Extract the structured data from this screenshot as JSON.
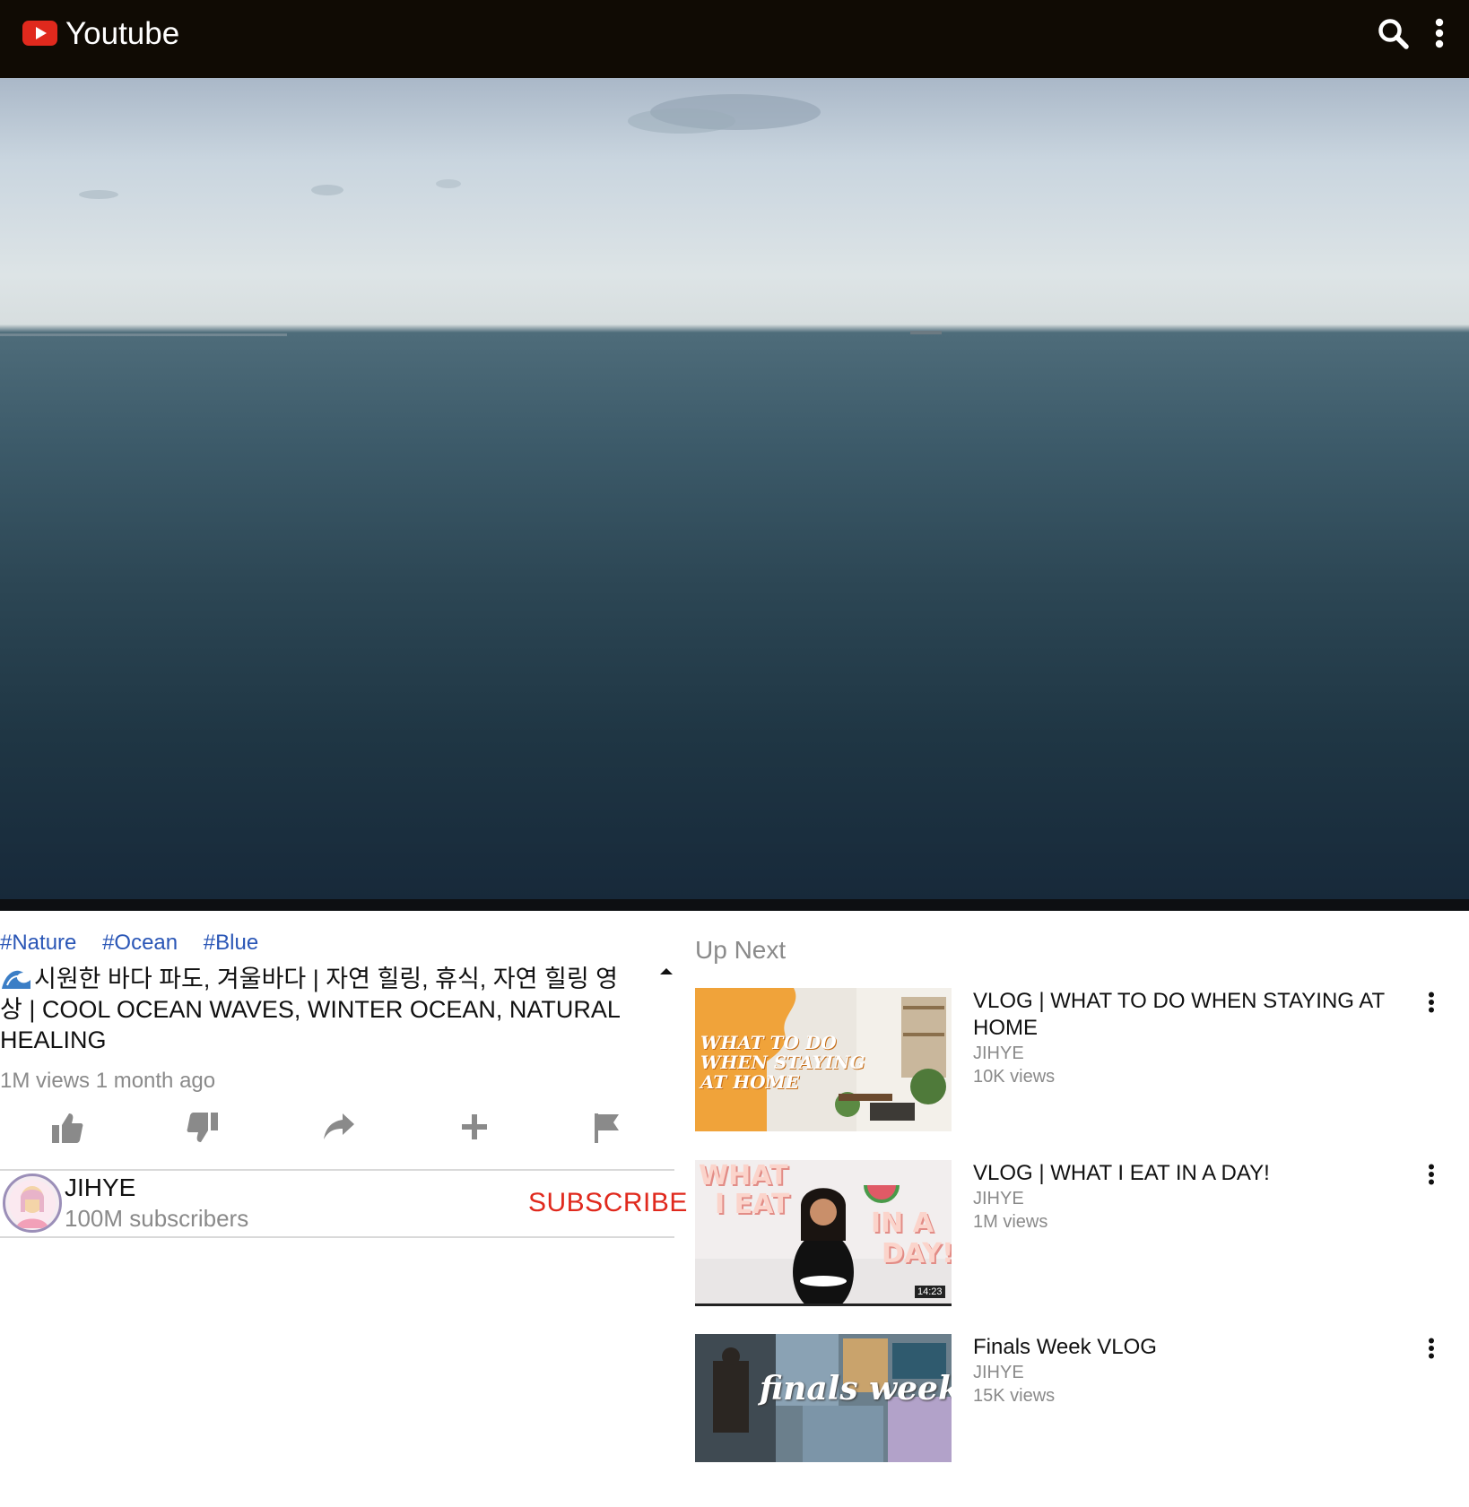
{
  "app": {
    "title": "Youtube",
    "accent": "#e0291d",
    "bar_color": "#100b04"
  },
  "video": {
    "tags": [
      "#Nature",
      "#Ocean",
      "#Blue"
    ],
    "title": "시원한 바다 파도, 겨울바다 | 자연 힐링, 휴식, 자연 힐링 영상 | COOL OCEAN WAVES, WINTER OCEAN, NATURAL HEALING",
    "meta": "1M views 1 month ago"
  },
  "actions": [
    "like-icon",
    "dislike-icon",
    "share-icon",
    "add-icon",
    "flag-icon"
  ],
  "channel": {
    "name": "JIHYE",
    "subscribers": "100M subscribers",
    "subscribe_label": "SUBSCRIBE"
  },
  "up_next": {
    "label": "Up Next",
    "items": [
      {
        "title": "VLOG | WHAT TO DO WHEN STAYING AT HOME",
        "channel": "JIHYE",
        "views": "10K views",
        "thumb_text": [
          "WHAT TO DO",
          "WHEN STAYING",
          "AT HOME"
        ]
      },
      {
        "title": "VLOG | WHAT I EAT IN A DAY!",
        "channel": "JIHYE",
        "views": "1M views",
        "thumb_text": [
          "WHAT",
          "I EAT",
          "IN A",
          "DAY!"
        ],
        "duration": "14:23"
      },
      {
        "title": "Finals Week VLOG",
        "channel": "JIHYE",
        "views": "15K views",
        "thumb_text": [
          "finals week."
        ]
      }
    ]
  }
}
